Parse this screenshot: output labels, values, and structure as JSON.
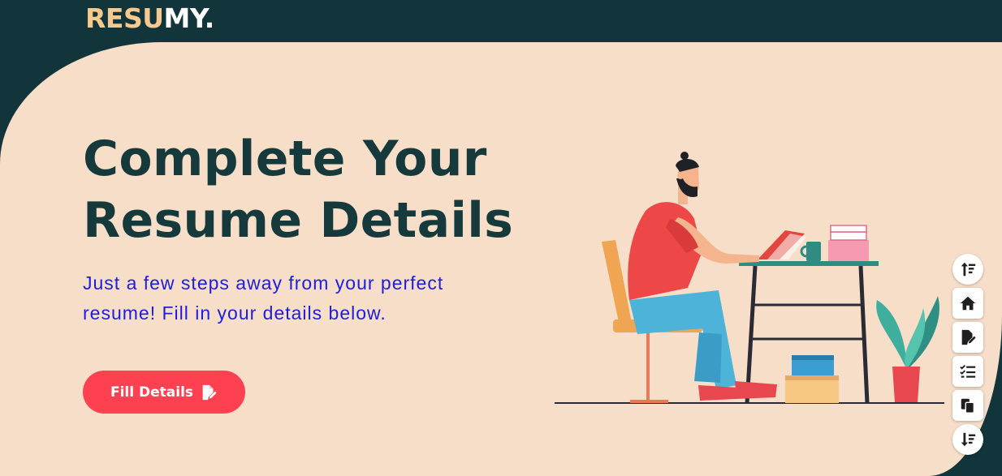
{
  "brand": {
    "part1": "RESU",
    "part2": "MY.",
    "accent_color": "#f6c98e"
  },
  "hero": {
    "title_line1": "Complete Your",
    "title_line2": "Resume Details",
    "subtitle_line1": "Just a few steps away from your perfect",
    "subtitle_line2": "resume! Fill in your details below.",
    "cta_label": "Fill Details",
    "cta_icon": "file-pen-icon"
  },
  "side_nav": [
    {
      "icon": "sort-up-icon"
    },
    {
      "icon": "home-icon"
    },
    {
      "icon": "file-edit-icon"
    },
    {
      "icon": "checklist-icon"
    },
    {
      "icon": "copy-icon"
    },
    {
      "icon": "sort-down-icon"
    }
  ],
  "colors": {
    "header_bg": "#12343b",
    "hero_bg": "#f7dec9",
    "title": "#163a3c",
    "subtitle": "#1d1de0",
    "button": "#fd4150"
  }
}
